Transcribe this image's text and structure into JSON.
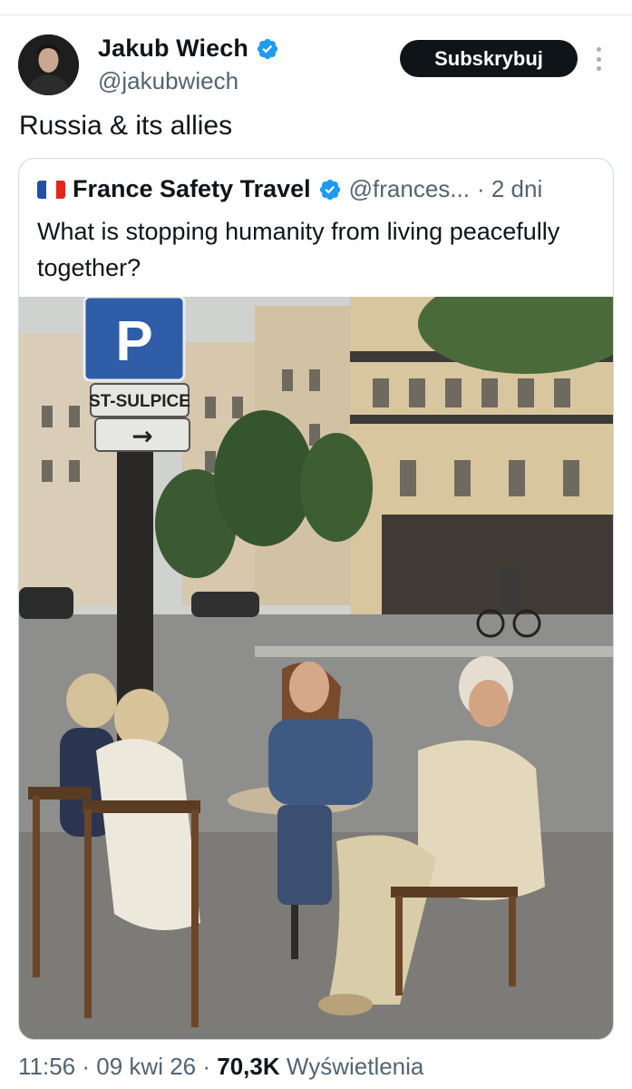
{
  "post": {
    "author_name": "Jakub Wiech",
    "author_handle": "@jakubwiech",
    "subscribe_label": "Subskrybuj",
    "text": "Russia & its allies",
    "time": "11:56",
    "date": "09 kwi 26",
    "views_count": "70,3K",
    "views_label": "Wyświetlenia",
    "separator": "·"
  },
  "quoted": {
    "author_name": "France Safety Travel",
    "author_handle": "@frances...",
    "age": "· 2 dni",
    "text": "What is stopping humanity from living peacefully together?",
    "sign_street": "ST-SULPICE",
    "sign_parking": "P",
    "sign_arrow": "→"
  },
  "colors": {
    "verified": "#1d9bf0",
    "subscribe_bg": "#0f1419",
    "secondary_text": "#536471",
    "border": "#cfd9de"
  },
  "icons": {
    "verified": "verified-badge-icon",
    "more": "more-dots-icon",
    "flag": "france-flag-icon"
  }
}
